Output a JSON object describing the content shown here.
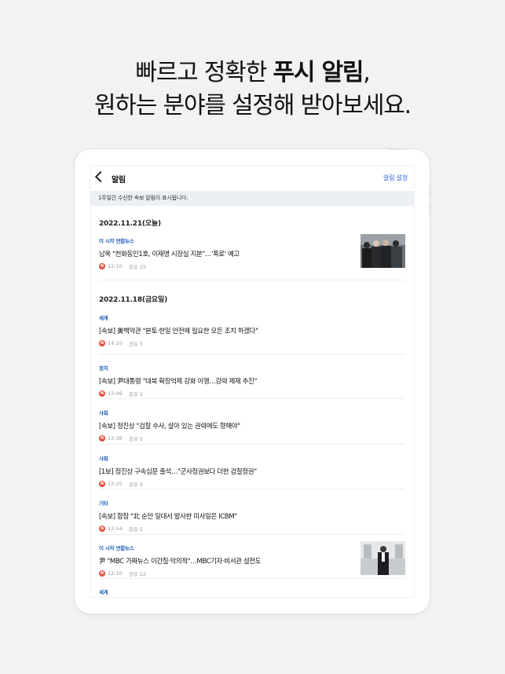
{
  "headline": {
    "line1_prefix": "빠르고 정확한 ",
    "line1_bold": "푸시 알림",
    "line1_suffix": ",",
    "line2": "원하는 분야를 설정해 받아보세요."
  },
  "app": {
    "title": "알림",
    "settings_label": "알림 설정",
    "notice": "1주일간 수신한 속보 알림이 표시됩니다."
  },
  "groups": [
    {
      "date": "2022.11.21(오늘)",
      "items": [
        {
          "category": "이 시각 연합뉴스",
          "headline": "남욱 \"천화동인1호, 이재명 시장실 지분\"…'폭로' 예고",
          "time": "12:10",
          "share": "공유 25",
          "thumb": "photo-people"
        }
      ]
    },
    {
      "date": "2022.11.18(금요일)",
      "items": [
        {
          "category": "세계",
          "headline": "[속보] 美백악관 \"본토·한일 안전에 필요한 모든 조치 하겠다\"",
          "time": "14:10",
          "share": "공유 5"
        },
        {
          "category": "정치",
          "headline": "[속보] 尹대통령 \"대북 확장억제 강화 이행…강력 제재 추진\"",
          "time": "13:49",
          "share": "공유 2"
        },
        {
          "category": "사회",
          "headline": "[속보] 정진상 \"검찰 수사, 살아 있는 권력에도 향해야\"",
          "time": "13:36",
          "share": "공유 5"
        },
        {
          "category": "사회",
          "headline": "[1보] 정진상 구속심문 출석…\"군사정권보다 더한 검찰정권\"",
          "time": "13:35",
          "share": "공유 5"
        },
        {
          "category": "기타",
          "headline": "[속보] 합참 \"北 순안 일대서 발사한 미사일은 ICBM\"",
          "time": "12:54",
          "share": "공유 5"
        },
        {
          "category": "이 시각 연합뉴스",
          "headline": "尹 \"MBC 가짜뉴스 이간질·악의적\"…MBC기자·비서관 설전도",
          "time": "12:10",
          "share": "공유 22",
          "thumb": "photo-person"
        },
        {
          "category": "세계",
          "headline": "",
          "time": "",
          "share": ""
        }
      ]
    }
  ],
  "colors": {
    "accent": "#2a66d8",
    "category": "#1e5fb8",
    "source_logo": "#e44d3a",
    "notice_bg": "#eceff4"
  },
  "source_logo_text": "N"
}
